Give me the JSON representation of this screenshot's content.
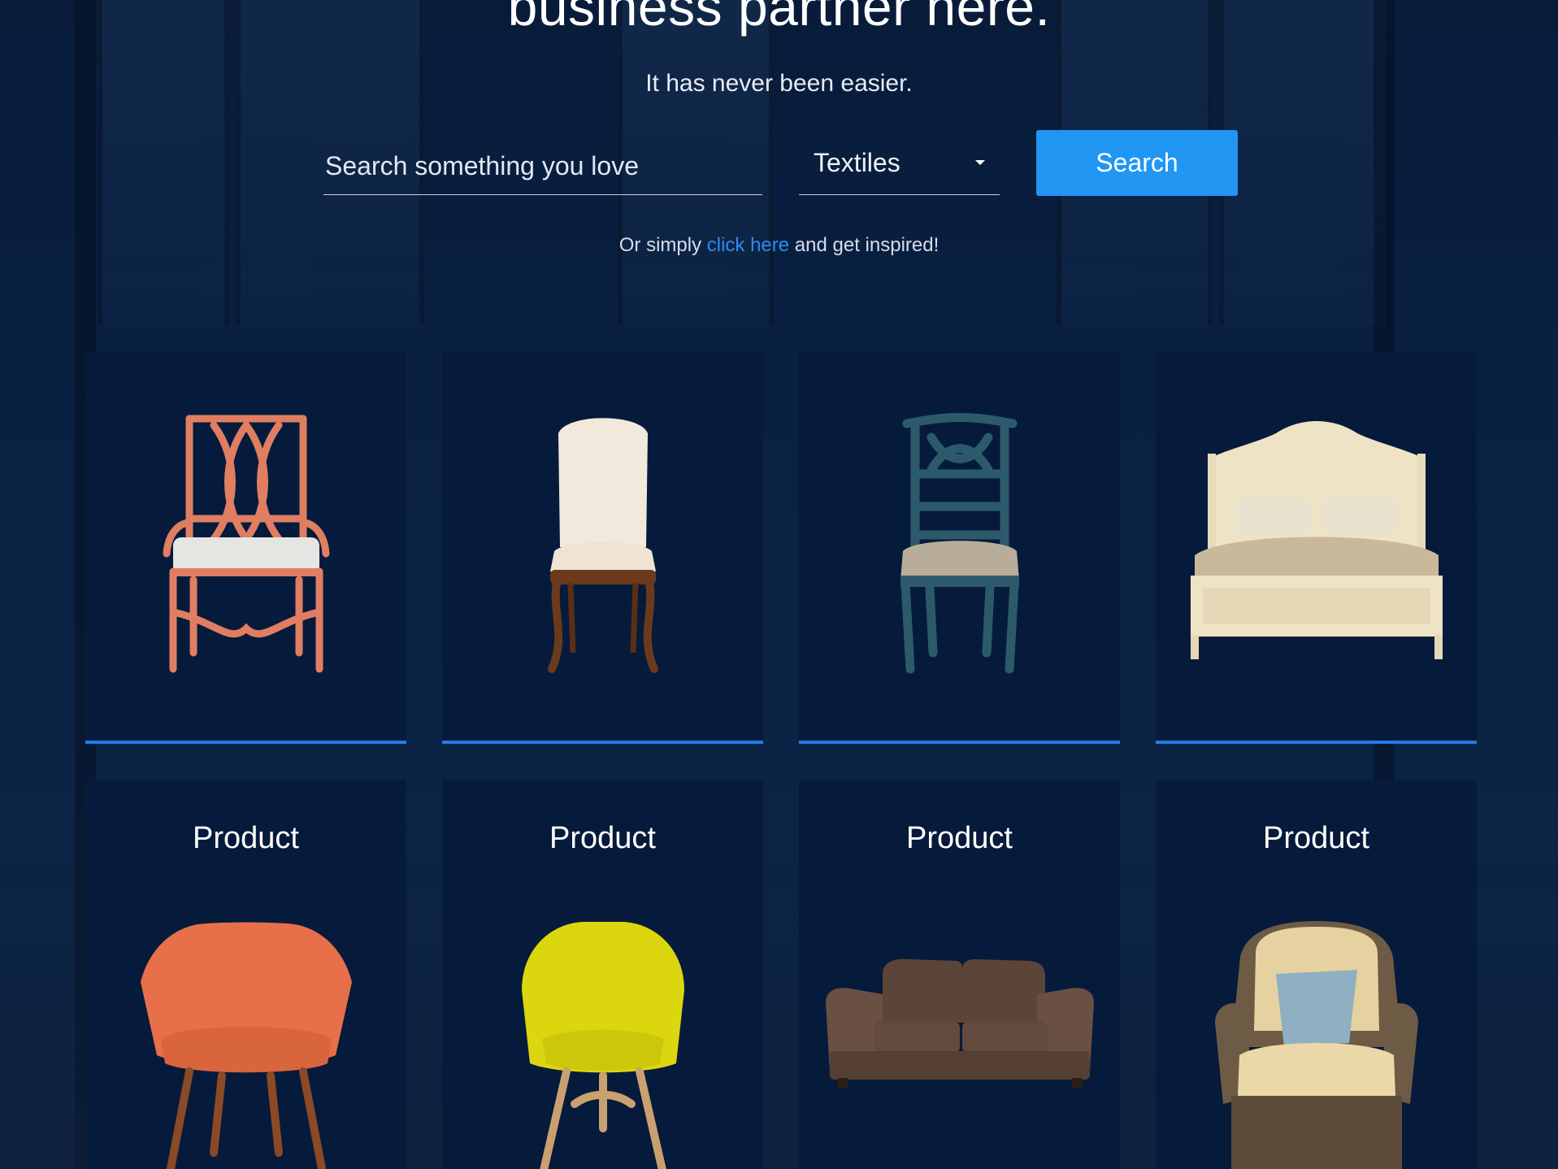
{
  "hero": {
    "headline": "business partner here.",
    "subline": "It has never been easier."
  },
  "search": {
    "placeholder": "Search something you love",
    "category": "Textiles",
    "button_label": "Search"
  },
  "inspire": {
    "prefix": "Or simply ",
    "link": "click here",
    "suffix": " and get inspired!"
  },
  "top_cards": [
    {
      "item": "orange-lattice-armchair"
    },
    {
      "item": "cream-upholstered-side-chair"
    },
    {
      "item": "teal-wood-dining-chair"
    },
    {
      "item": "cream-panel-bed"
    }
  ],
  "bottom_cards": [
    {
      "title": "Product",
      "item": "orange-accent-chair"
    },
    {
      "title": "Product",
      "item": "yellow-accent-chair"
    },
    {
      "title": "Product",
      "item": "brown-loveseat-sofa"
    },
    {
      "title": "Product",
      "item": "wicker-armchair"
    }
  ],
  "colors": {
    "accent": "#2196f3",
    "link": "#2a8cf0",
    "card_bg": "#061b3b",
    "card_underline": "#1e7ee6"
  }
}
